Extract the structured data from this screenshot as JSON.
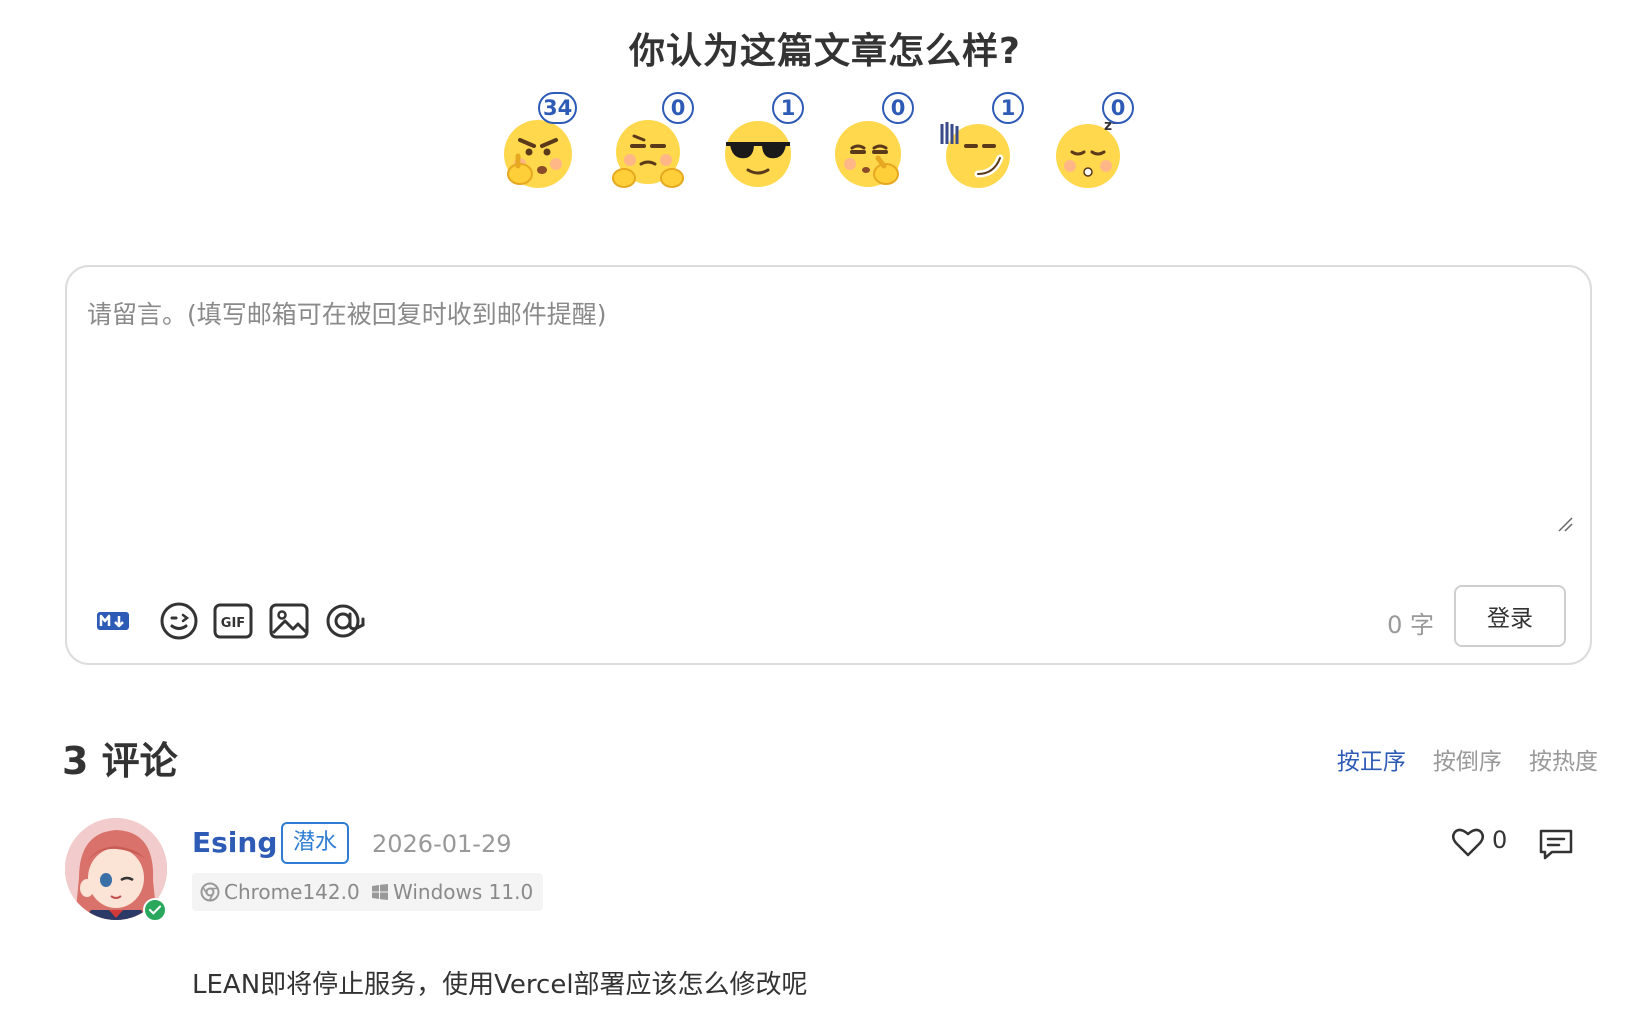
{
  "reaction_title": "你认为这篇文章怎么样?",
  "reactions": [
    {
      "icon": "angry-thinking-emoji-icon",
      "count": "34"
    },
    {
      "icon": "shrug-emoji-icon",
      "count": "0"
    },
    {
      "icon": "cool-sunglasses-emoji-icon",
      "count": "1"
    },
    {
      "icon": "pondering-emoji-icon",
      "count": "0"
    },
    {
      "icon": "awkward-smirk-emoji-icon",
      "count": "1"
    },
    {
      "icon": "sleepy-emoji-icon",
      "count": "0"
    }
  ],
  "editor": {
    "placeholder": "请留言。(填写邮箱可在被回复时收到邮件提醒)",
    "word_count": "0 字",
    "login_label": "登录",
    "toolbar": [
      "markdown-icon",
      "emoji-icon",
      "gif-icon",
      "image-icon",
      "preview-icon"
    ]
  },
  "comments_header": {
    "count_label": "3 评论",
    "sort_options": [
      "按正序",
      "按倒序",
      "按热度"
    ],
    "active_sort": "按正序"
  },
  "comment": {
    "author": "Esing",
    "tag": "潜水",
    "date": "2026-01-29",
    "browser": "Chrome142.0",
    "os": "Windows 11.0",
    "likes": "0",
    "text": "LEAN即将停止服务，使用Vercel部署应该怎么修改呢"
  },
  "colors": {
    "accent": "#2e5bb5",
    "tag": "#2e7dd3",
    "muted": "#999999",
    "verified": "#29a85d"
  }
}
